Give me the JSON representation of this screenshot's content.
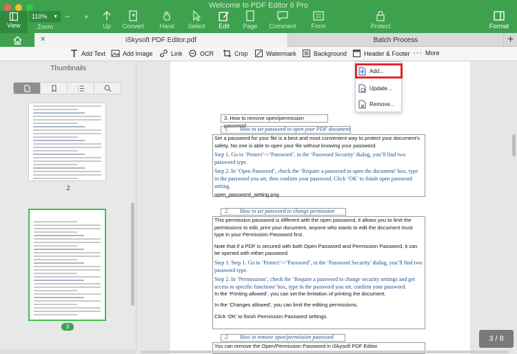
{
  "app": {
    "window_title": "Welcome to PDF Editor 6 Pro"
  },
  "toolbar": {
    "view_label": "View",
    "zoom_value": "110%",
    "zoom_label": "Zoom",
    "zoom_minus": "−",
    "zoom_plus": "+",
    "items": [
      {
        "label": "Up",
        "icon": "up-arrow-icon"
      },
      {
        "label": "Convert",
        "icon": "convert-icon"
      },
      {
        "label": "Hand",
        "icon": "hand-icon"
      },
      {
        "label": "Select",
        "icon": "cursor-icon"
      },
      {
        "label": "Edit",
        "icon": "edit-icon"
      },
      {
        "label": "Page",
        "icon": "page-icon"
      },
      {
        "label": "Comment",
        "icon": "comment-icon"
      },
      {
        "label": "Form",
        "icon": "form-icon"
      },
      {
        "label": "Protect",
        "icon": "protect-icon"
      }
    ],
    "format_label": "Format"
  },
  "tabs": {
    "document_tab": "iSkysoft PDF Editor.pdf",
    "close_symbol": "✕",
    "batch_tab": "Batch Process",
    "add_tab_symbol": "+"
  },
  "edit_toolbar": {
    "add_text": "Add Text",
    "add_image": "Add Image",
    "link": "Link",
    "ocr": "OCR",
    "crop": "Crop",
    "watermark": "Watermark",
    "background": "Background",
    "header_footer": "Header & Footer",
    "more": "More"
  },
  "sidebar": {
    "title": "Thumbnails",
    "thumbnails": [
      {
        "page": "2"
      },
      {
        "page": "3"
      }
    ]
  },
  "dropdown": {
    "items": [
      "Add...",
      "Update...",
      "Remove..."
    ]
  },
  "document": {
    "section3_title": "3.    How to remove open/permission password",
    "h1": {
      "num": "1.",
      "text": "How to set password to open your PDF document"
    },
    "p1": "Set a password for your file is a best and most convenient way to protect your document’s safety. No one is able to open your file without knowing your password.",
    "p1_step1": "Step 1. Go to ‘Protect’->’Password’, in the ‘Password Security’ dialog, you’ll find two password type.",
    "p1_step2": "Step 2. In ‘Open Password’, check the ‘Require a password to open the document’ box, type in the password you set, then confirm your password. Click ‘OK’ to finish open password setting.",
    "p1_file": "open_password_setting.png",
    "h2": {
      "num": "2.",
      "text": "How to set password to change permission"
    },
    "p2": "This permission password is different with the open password, it allows you to limit the permissions to edit, print your document, anyone who wants to edit the document must type in your Permission Password first.",
    "p2_note": "Note that if a PDF is secured with both Open Password and Permission Password, it can be opened with either password.",
    "p2_step1": "Step 1. Step 1. Go to ‘Protect’->’Password’, in the ‘Password Security’ dialog, you’ll find two password type.",
    "p2_step2": "Step 2. In ‘Permissions’, check the ‘Require a password to change security settings and get access to specific functions’ box, type in the password you set, confirm your password.",
    "p2_print": "In the ‘Printing allowed’, you can set the limitation of printing the document.",
    "p2_changes": "In the ‘Changes allowed’, you can limit the editing permissions.",
    "p2_ok": "Click ‘OK’ to finish Permission Password settings.",
    "h3": {
      "num": "2.",
      "text": "How to remove open/permission password"
    },
    "p3": "You can remove the Open/Permission Password in iSkysoft PDF Editor."
  },
  "page_counter": "3 / 8",
  "colors": {
    "brand_green": "#3ea14e",
    "highlight_red": "#e3262b",
    "heading_blue": "#2a4e8a"
  }
}
